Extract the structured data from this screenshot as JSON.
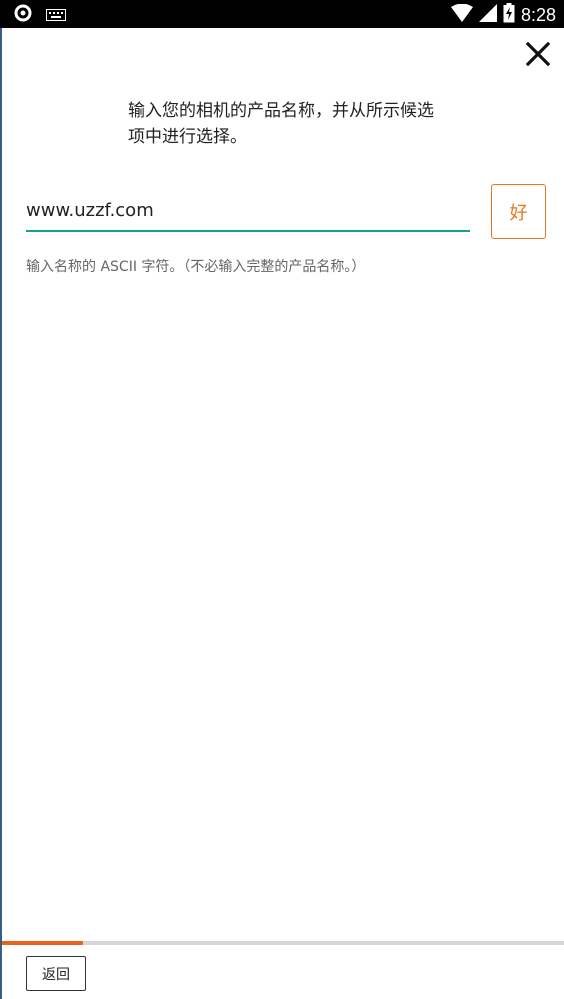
{
  "status_bar": {
    "time": "8:28",
    "left_icons": [
      "app-circle-icon",
      "keyboard-icon"
    ],
    "right_icons": [
      "wifi-icon",
      "signal-icon",
      "battery-charging-icon"
    ]
  },
  "dialog": {
    "instruction": "输入您的相机的产品名称，并从所示候选项中进行选择。",
    "input": {
      "value": "www.uzzf.com",
      "placeholder": ""
    },
    "ok_label": "好",
    "hint": "输入名称的 ASCII 字符。（不必输入完整的产品名称。）",
    "close_icon": "close-icon"
  },
  "footer": {
    "progress": 0.145,
    "back_label": "返回"
  },
  "colors": {
    "accent": "#e87722",
    "input_underline": "#11a38f",
    "progress_fill": "#e8631c",
    "progress_track": "#d6d6d6"
  }
}
